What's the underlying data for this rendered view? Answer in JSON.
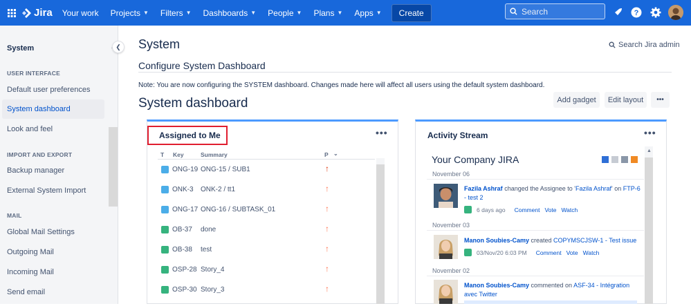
{
  "topbar": {
    "product": "Jira",
    "nav": [
      {
        "label": "Your work",
        "dropdown": false
      },
      {
        "label": "Projects",
        "dropdown": true
      },
      {
        "label": "Filters",
        "dropdown": true
      },
      {
        "label": "Dashboards",
        "dropdown": true
      },
      {
        "label": "People",
        "dropdown": true
      },
      {
        "label": "Plans",
        "dropdown": true
      },
      {
        "label": "Apps",
        "dropdown": true
      }
    ],
    "create_label": "Create",
    "search_placeholder": "Search",
    "icons": [
      "notifications-icon",
      "help-icon",
      "settings-icon",
      "avatar"
    ]
  },
  "sidebar": {
    "title": "System",
    "sections": [
      {
        "label": "USER INTERFACE"
      },
      {
        "label": "IMPORT AND EXPORT"
      },
      {
        "label": "MAIL"
      }
    ],
    "items": [
      {
        "label": "Default user preferences"
      },
      {
        "label": "System dashboard",
        "active": true
      },
      {
        "label": "Look and feel"
      },
      {
        "label": "Backup manager"
      },
      {
        "label": "External System Import"
      },
      {
        "label": "Global Mail Settings"
      },
      {
        "label": "Outgoing Mail"
      },
      {
        "label": "Incoming Mail"
      },
      {
        "label": "Send email"
      }
    ]
  },
  "main": {
    "title": "System",
    "admin_search": "Search Jira admin",
    "subtitle": "Configure System Dashboard",
    "note": "Note: You are now configuring the SYSTEM dashboard. Changes made here will affect all users using the default system dashboard.",
    "dashboard_title": "System dashboard",
    "add_gadget": "Add gadget",
    "edit_layout": "Edit layout",
    "more": "•••"
  },
  "assigned": {
    "title": "Assigned to Me",
    "more": "•••",
    "headers": {
      "type": "T",
      "key": "Key",
      "summary": "Summary",
      "priority": "P"
    },
    "rows": [
      {
        "type": "subtask",
        "key": "ONG-19",
        "parent": "ONG-15",
        "summary": "SUB1",
        "priority": "highest"
      },
      {
        "type": "subtask",
        "key": "ONK-3",
        "parent": "ONK-2",
        "summary": "tt1",
        "priority": "high"
      },
      {
        "type": "subtask",
        "key": "ONG-17",
        "parent": "ONG-16",
        "summary": "SUBTASK_01",
        "priority": "high"
      },
      {
        "type": "story",
        "key": "OB-37",
        "parent": "",
        "summary": "done",
        "priority": "high"
      },
      {
        "type": "story",
        "key": "OB-38",
        "parent": "",
        "summary": "test",
        "priority": "high"
      },
      {
        "type": "story",
        "key": "OSP-28",
        "parent": "",
        "summary": "Story_4",
        "priority": "high"
      },
      {
        "type": "story",
        "key": "OSP-30",
        "parent": "",
        "summary": "Story_3",
        "priority": "high"
      }
    ],
    "colors": {
      "highest": "#de350b",
      "high": "#ff7452"
    }
  },
  "activity": {
    "title": "Activity Stream",
    "more": "•••",
    "company": "Your Company JIRA",
    "groups": [
      {
        "date": "November 06",
        "actor": "Fazila Ashraf",
        "action": " changed the Assignee to '",
        "target": "Fazila Ashraf",
        "rest": "' on ",
        "issue": "FTP-6 - test 2",
        "when": "6 days ago",
        "links": [
          "Comment",
          "Vote",
          "Watch"
        ]
      },
      {
        "date": "November 03",
        "actor": "Manon Soubies-Camy",
        "action": " created ",
        "issue": "COPYMSCJSW-1 - Test issue",
        "when": "03/Nov/20 6:03 PM",
        "links": [
          "Comment",
          "Vote",
          "Watch"
        ]
      },
      {
        "date": "November 02",
        "actor": "Manon Soubies-Camy",
        "action": " commented on ",
        "issue": "ASF-34 - Intégration avec Twitter"
      }
    ]
  }
}
